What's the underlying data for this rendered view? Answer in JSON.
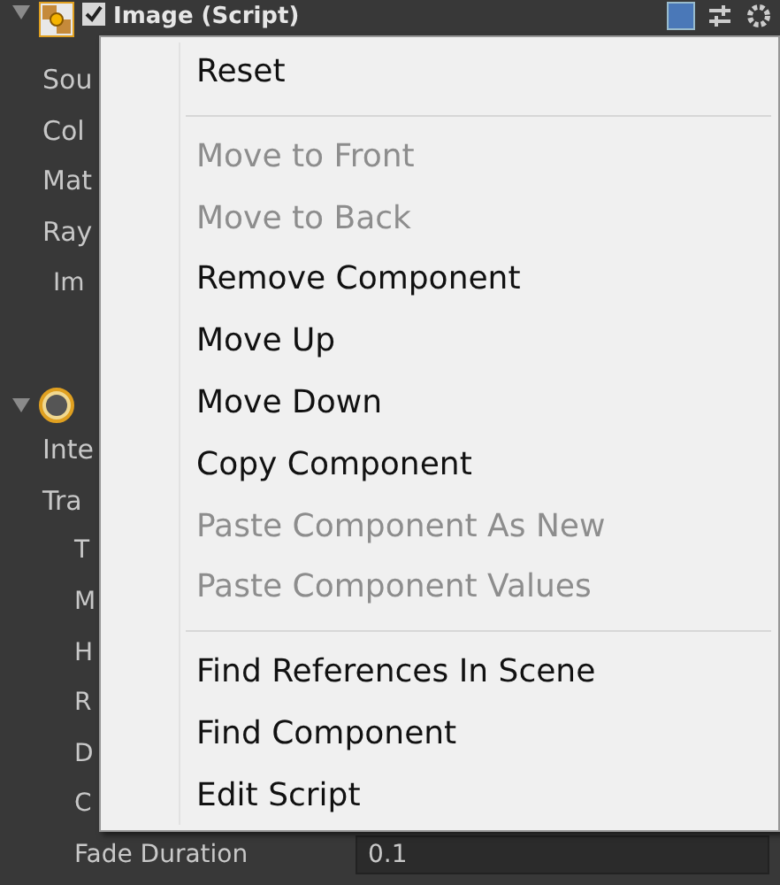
{
  "inspector": {
    "components": [
      {
        "title": "Image (Script)",
        "enabled": true,
        "rows": [
          {
            "label": "Sou"
          },
          {
            "label": "Col"
          },
          {
            "label": "Mat"
          },
          {
            "label": "Ray"
          },
          {
            "label": "Im",
            "indent": true
          }
        ]
      },
      {
        "rows": [
          {
            "label": "Inte"
          },
          {
            "label": "Tra"
          },
          {
            "label": "T",
            "indent": true
          },
          {
            "label": "M",
            "indent": true
          },
          {
            "label": "H",
            "indent": true
          },
          {
            "label": "R",
            "indent": true
          },
          {
            "label": "D",
            "indent": true
          },
          {
            "label": "C",
            "indent": true
          },
          {
            "label": "Fade Duration",
            "indent": true,
            "value": "0.1"
          }
        ]
      }
    ]
  },
  "context_menu": {
    "groups": [
      [
        {
          "label": "Reset",
          "disabled": false
        }
      ],
      [
        {
          "label": "Move to Front",
          "disabled": true
        },
        {
          "label": "Move to Back",
          "disabled": true
        },
        {
          "label": "Remove Component",
          "disabled": false
        },
        {
          "label": "Move Up",
          "disabled": false
        },
        {
          "label": "Move Down",
          "disabled": false
        },
        {
          "label": "Copy Component",
          "disabled": false
        },
        {
          "label": "Paste Component As New",
          "disabled": true
        },
        {
          "label": "Paste Component Values",
          "disabled": true
        }
      ],
      [
        {
          "label": "Find References In Scene",
          "disabled": false
        },
        {
          "label": "Find Component",
          "disabled": false
        },
        {
          "label": "Edit Script",
          "disabled": false
        }
      ]
    ]
  }
}
